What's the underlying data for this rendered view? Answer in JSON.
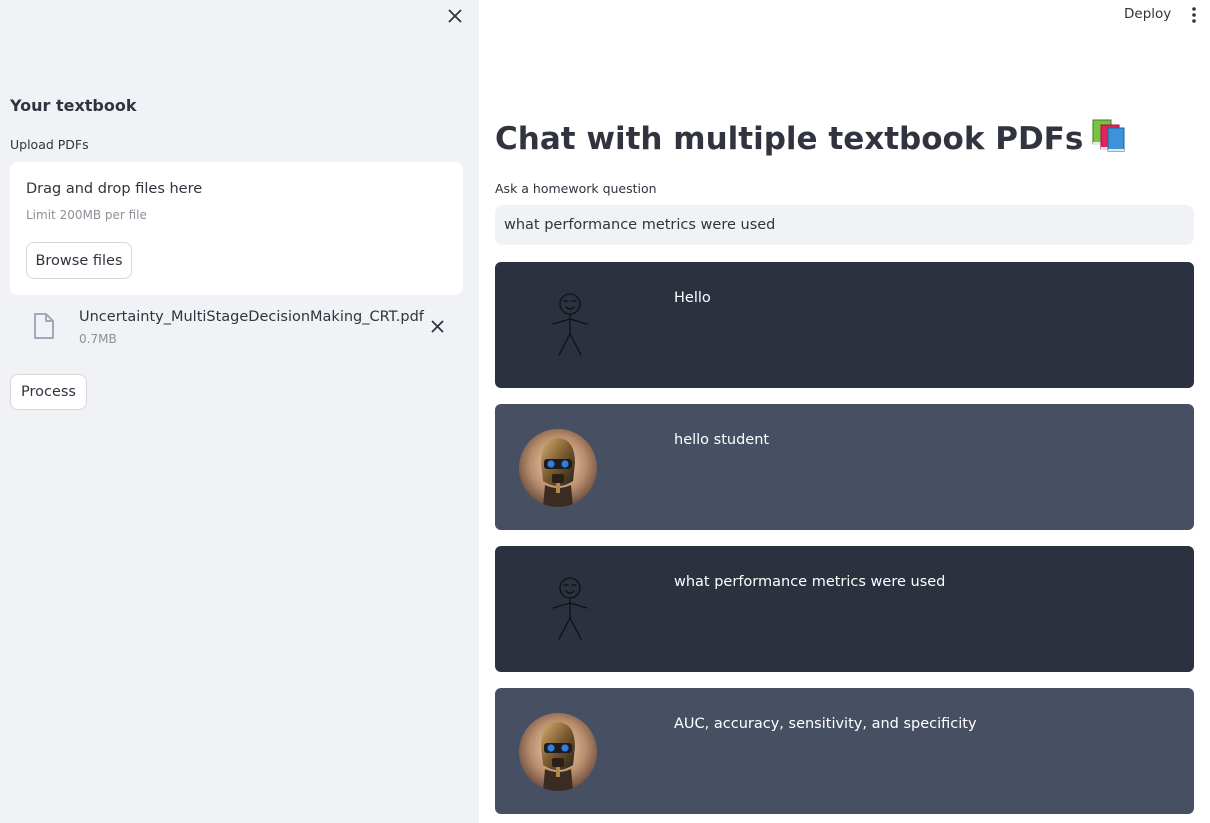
{
  "sidebar": {
    "title": "Your textbook",
    "upload_label": "Upload PDFs",
    "dropzone": {
      "main_text": "Drag and drop files here",
      "limit_text": "Limit 200MB per file",
      "browse_label": "Browse files"
    },
    "file": {
      "name": "Uncertainty_MultiStageDecisionMaking_CRT.pdf",
      "size": "0.7MB"
    },
    "process_label": "Process"
  },
  "header": {
    "deploy_label": "Deploy"
  },
  "main": {
    "title": "Chat with multiple textbook PDFs",
    "title_emoji": "books-emoji",
    "question_label": "Ask a homework question",
    "question_value": "what performance metrics were used",
    "messages": [
      {
        "role": "user",
        "avatar": "stick-figure-icon",
        "text": "Hello"
      },
      {
        "role": "bot",
        "avatar": "robot-avatar",
        "text": "hello student"
      },
      {
        "role": "user",
        "avatar": "stick-figure-icon",
        "text": "what performance metrics were used"
      },
      {
        "role": "bot",
        "avatar": "robot-avatar",
        "text": "AUC, accuracy, sensitivity, and specificity"
      }
    ]
  },
  "colors": {
    "sidebar_bg": "#f0f2f6",
    "user_msg_bg": "#2b313e",
    "bot_msg_bg": "#475063",
    "text": "#31333f"
  }
}
